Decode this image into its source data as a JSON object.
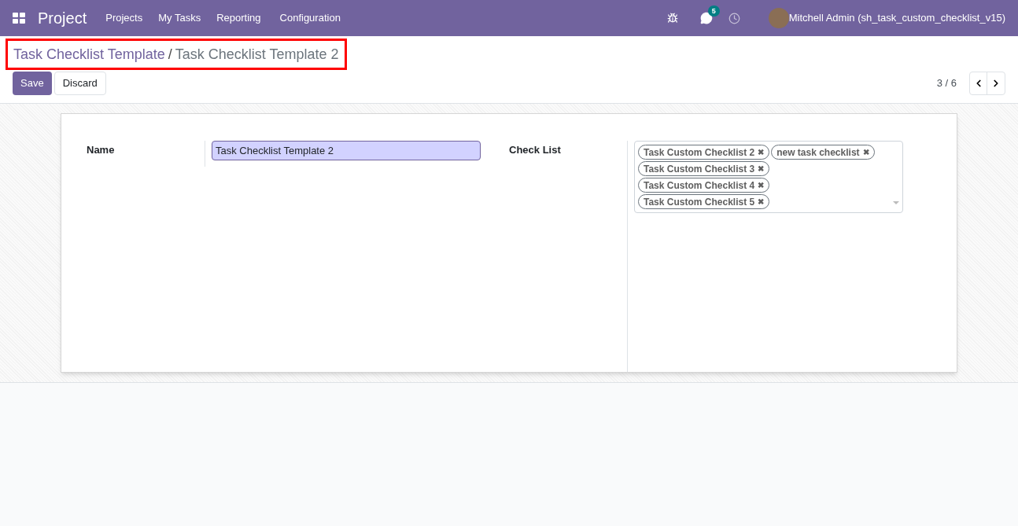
{
  "navbar": {
    "app": "Project",
    "menu": [
      "Projects",
      "My Tasks",
      "Reporting",
      "Configuration"
    ],
    "messages_count": "5",
    "user": "Mitchell Admin (sh_task_custom_checklist_v15)"
  },
  "breadcrumb": {
    "parent": "Task Checklist Template",
    "separator": "/",
    "current": "Task Checklist Template 2",
    "highlighted": true
  },
  "buttons": {
    "save": "Save",
    "discard": "Discard"
  },
  "pager": "3 / 6",
  "form": {
    "name_label": "Name",
    "name_value": "Task Checklist Template 2",
    "checklist_label": "Check List",
    "tags": [
      {
        "label": "Task Custom Checklist 2",
        "remove": "✖"
      },
      {
        "label": "new task checklist",
        "remove": "✖"
      },
      {
        "label": "Task Custom Checklist 3",
        "remove": "✖"
      },
      {
        "label": "Task Custom Checklist 4",
        "remove": "✖"
      },
      {
        "label": "Task Custom Checklist 5",
        "remove": "✖"
      }
    ]
  }
}
